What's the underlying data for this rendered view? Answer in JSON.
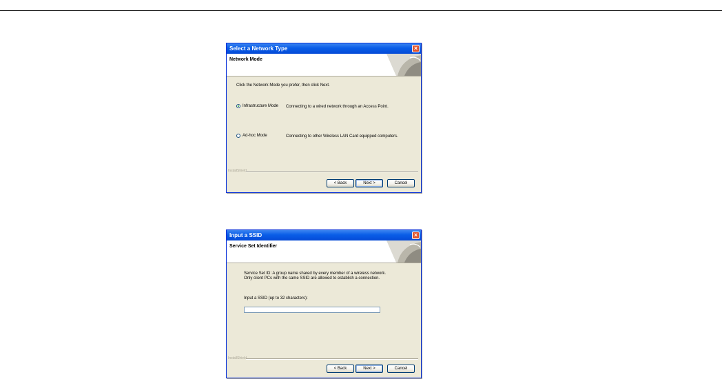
{
  "dialog1": {
    "title": "Select a Network Type",
    "banner_title": "Network Mode",
    "instruction": "Click the Network Mode you prefer, then click Next.",
    "options": [
      {
        "label": "Infrastructure Mode",
        "description": "Connecting to a wired network through an Access Point.",
        "selected": true
      },
      {
        "label": "Ad-hoc Mode",
        "description": "Connecting to other Wireless LAN Card equipped computers.",
        "selected": false
      }
    ],
    "installshield": "InstallShield",
    "buttons": {
      "back": "< Back",
      "next": "Next >",
      "cancel": "Cancel"
    }
  },
  "dialog2": {
    "title": "Input a SSID",
    "banner_title": "Service Set Identifier",
    "description_line1": "Service Set ID: A group name shared by every member of a wireless network.",
    "description_line2": "Only client PCs with the same SSID are allowed to establish a connection.",
    "input_label": "Input a SSID (up to 32 characters):",
    "ssid_value": "",
    "installshield": "InstallShield",
    "buttons": {
      "back": "< Back",
      "next": "Next >",
      "cancel": "Cancel"
    }
  },
  "colors": {
    "titlebar": "#0a5ee8",
    "dialog_bg": "#ece9d8",
    "close_button": "#e0552e"
  }
}
